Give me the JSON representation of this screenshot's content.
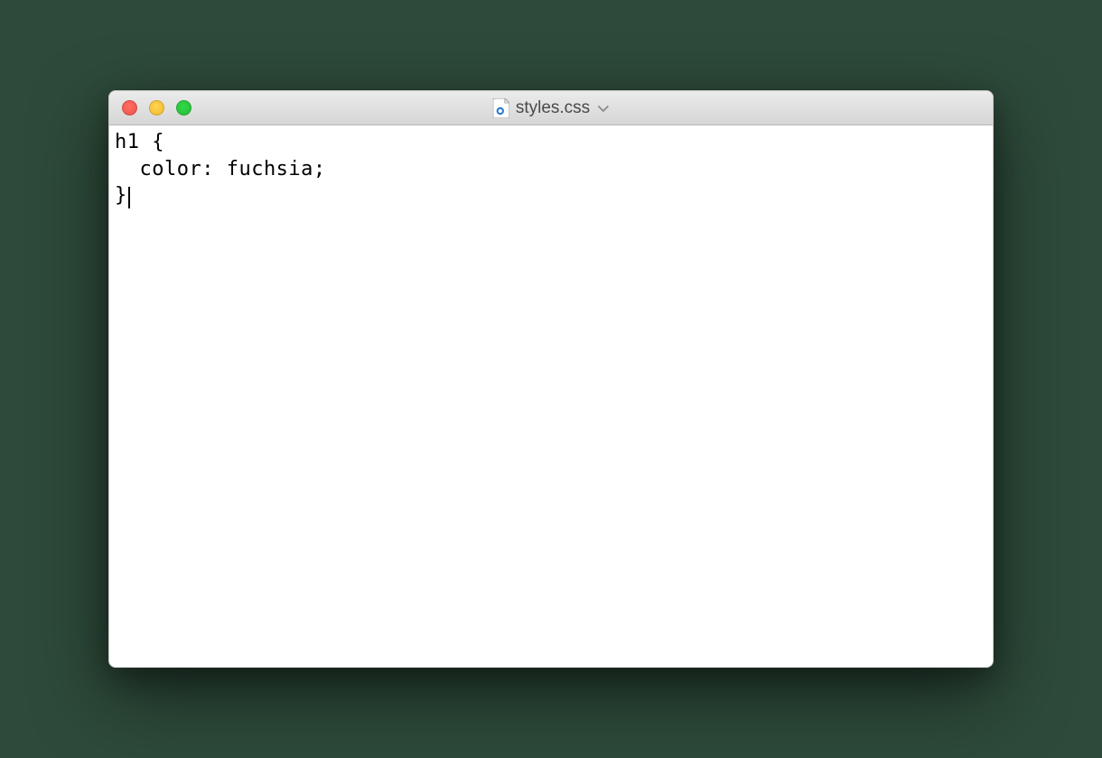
{
  "window": {
    "title": "styles.css",
    "file_icon": "css-file-icon"
  },
  "traffic_lights": {
    "close": "close",
    "minimize": "minimize",
    "maximize": "maximize"
  },
  "editor": {
    "lines": [
      "h1 {",
      "  color: fuchsia;",
      "}"
    ],
    "cursor_line": 2,
    "cursor_after": "}"
  }
}
